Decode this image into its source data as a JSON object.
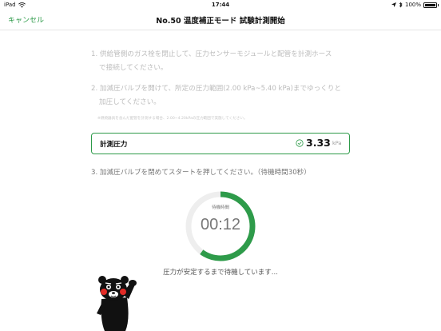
{
  "status_bar": {
    "device": "iPad",
    "time": "17:44",
    "battery": "100%"
  },
  "nav": {
    "cancel_label": "キャンセル",
    "title": "No.50 温度補正モード 試験計測開始"
  },
  "steps": {
    "step1_line1": "1. 供給管側のガス栓を閉止して、圧力センサーモジュールと配管を計測ホース",
    "step1_line2": "で接続してください。",
    "step2_line1": "2. 加減圧バルブを開けて、所定の圧力範囲(2.00 kPa~5.40 kPa)までゆっくりと",
    "step2_line2": "加圧してください。",
    "step2_note": "※燃焼器具を含んだ配管を計測する場合、2.00~4.20kPaの圧力範囲で実施してください。",
    "step3": "3. 加減圧バルブを閉めてスタートを押してください。（待機時間30秒）"
  },
  "pressure": {
    "label": "計測圧力",
    "value": "3.33",
    "unit": "kPa"
  },
  "timer": {
    "label": "待機時間",
    "remaining": "00:12",
    "total_seconds": 30,
    "progress_fraction": 0.6,
    "ring_color": "#2e9b4a",
    "track_color": "#eeeeee"
  },
  "waiting_message": "圧力が安定するまで待機しています...",
  "colors": {
    "accent": "#2e9b4a"
  },
  "icons": {
    "wifi": "wifi-icon",
    "location": "location-arrow-icon",
    "bluetooth": "bluetooth-icon",
    "battery": "battery-icon",
    "check": "check-circle-icon",
    "mascot": "kumamon-mascot"
  }
}
